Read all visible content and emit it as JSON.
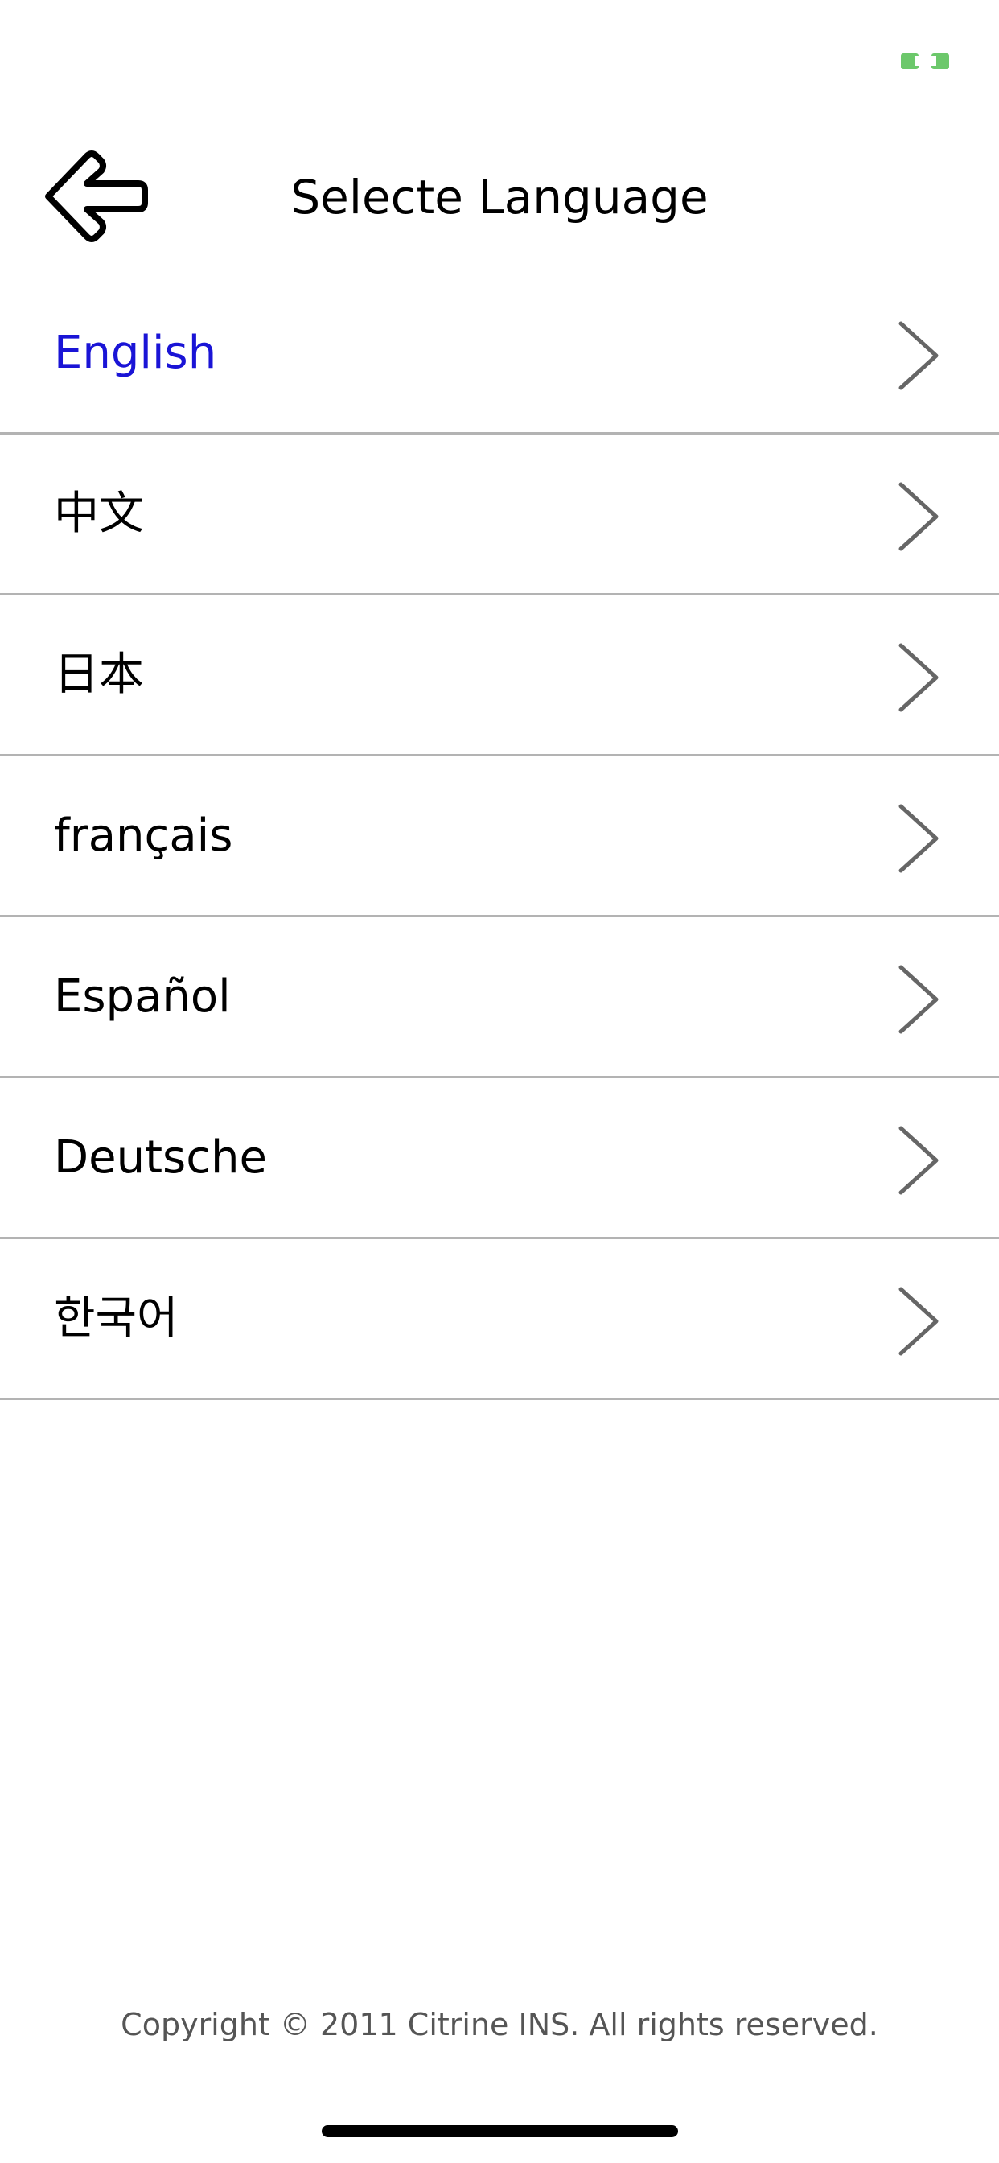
{
  "colors": {
    "selected_text": "#1a14d6",
    "default_text": "#000000",
    "separator": "#b3b3b3",
    "chevron": "#666666",
    "battery": "#6cc86b",
    "footer_text": "#555555"
  },
  "status_bar": {
    "battery_icon": "battery-icon"
  },
  "nav": {
    "back_icon": "back-arrow-icon",
    "title": "Selecte Language"
  },
  "languages": [
    {
      "label": "English",
      "selected": true
    },
    {
      "label": "中文",
      "selected": false
    },
    {
      "label": "日本",
      "selected": false
    },
    {
      "label": "français",
      "selected": false
    },
    {
      "label": "Español",
      "selected": false
    },
    {
      "label": "Deutsche",
      "selected": false
    },
    {
      "label": "한국어",
      "selected": false
    }
  ],
  "row_icon": "chevron-right-icon",
  "footer": {
    "copyright": "Copyright © 2011 Citrine INS. All rights reserved."
  }
}
